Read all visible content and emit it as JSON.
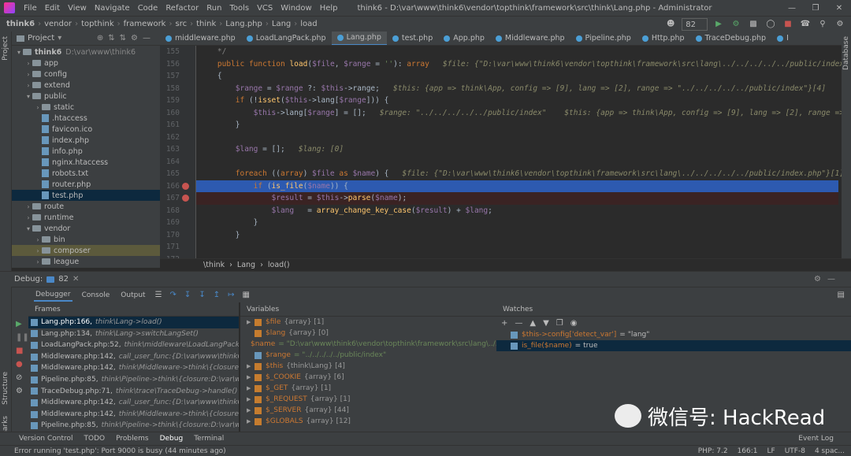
{
  "window": {
    "title": "think6 - D:\\var\\www\\think6\\vendor\\topthink\\framework\\src\\think\\Lang.php - Administrator"
  },
  "menu": [
    "File",
    "Edit",
    "View",
    "Navigate",
    "Code",
    "Refactor",
    "Run",
    "Tools",
    "VCS",
    "Window",
    "Help"
  ],
  "breadcrumb": [
    "think6",
    "vendor",
    "topthink",
    "framework",
    "src",
    "think",
    "Lang.php",
    "Lang",
    "load"
  ],
  "toolbar": {
    "run_config": "82"
  },
  "project": {
    "header": "Project",
    "tree": [
      {
        "label": "think6",
        "extra": "D:\\var\\www\\think6",
        "type": "folder",
        "indent": 0,
        "open": true
      },
      {
        "label": "app",
        "type": "folder",
        "indent": 1
      },
      {
        "label": "config",
        "type": "folder",
        "indent": 1
      },
      {
        "label": "extend",
        "type": "folder",
        "indent": 1
      },
      {
        "label": "public",
        "type": "folder",
        "indent": 1,
        "open": true
      },
      {
        "label": "static",
        "type": "folder",
        "indent": 2
      },
      {
        "label": ".htaccess",
        "type": "file",
        "indent": 2
      },
      {
        "label": "favicon.ico",
        "type": "file",
        "indent": 2
      },
      {
        "label": "index.php",
        "type": "file",
        "indent": 2
      },
      {
        "label": "info.php",
        "type": "file",
        "indent": 2
      },
      {
        "label": "nginx.htaccess",
        "type": "file",
        "indent": 2
      },
      {
        "label": "robots.txt",
        "type": "file",
        "indent": 2
      },
      {
        "label": "router.php",
        "type": "file",
        "indent": 2
      },
      {
        "label": "test.php",
        "type": "file",
        "indent": 2,
        "selected": true
      },
      {
        "label": "route",
        "type": "folder",
        "indent": 1
      },
      {
        "label": "runtime",
        "type": "folder",
        "indent": 1
      },
      {
        "label": "vendor",
        "type": "folder",
        "indent": 1,
        "open": true
      },
      {
        "label": "bin",
        "type": "folder",
        "indent": 2
      },
      {
        "label": "composer",
        "type": "folder",
        "indent": 2,
        "selected": true
      },
      {
        "label": "league",
        "type": "folder",
        "indent": 2
      }
    ]
  },
  "tabs": [
    "middleware.php",
    "LoadLangPack.php",
    "Lang.php",
    "test.php",
    "App.php",
    "Middleware.php",
    "Pipeline.php",
    "Http.php",
    "TraceDebug.php",
    "I"
  ],
  "active_tab": "Lang.php",
  "editor": {
    "line_numbers": [
      "155",
      "156",
      "157",
      "158",
      "159",
      "160",
      "161",
      "162",
      "163",
      "164",
      "165",
      "166",
      "167",
      "168",
      "169",
      "170",
      "171",
      "172"
    ],
    "lines": [
      {
        "code": "    */",
        "hint": ""
      },
      {
        "code": "    public function load($file, $range = ''): array",
        "hint": "   $file: {\"D:\\var\\www\\think6\\vendor\\topthink\\framework\\src\\lang\\../../../../../public/index.php\"}"
      },
      {
        "code": "    {",
        "hint": ""
      },
      {
        "code": "        $range = $range ?: $this->range;",
        "hint": "   $this: {app => think\\App, config => [9], lang => [2], range => \"../../../../../public/index\"}[4]"
      },
      {
        "code": "        if (!isset($this->lang[$range])) {",
        "hint": ""
      },
      {
        "code": "            $this->lang[$range] = [];",
        "hint": "   $range: \"../../../../../public/index\"    $this: {app => think\\App, config => [9], lang => [2], range => \""
      },
      {
        "code": "        }",
        "hint": ""
      },
      {
        "code": "",
        "hint": ""
      },
      {
        "code": "        $lang = [];",
        "hint": "   $lang: [0]"
      },
      {
        "code": "",
        "hint": ""
      },
      {
        "code": "        foreach ((array) $file as $name) {",
        "hint": "   $file: {\"D:\\var\\www\\think6\\vendor\\topthink\\framework\\src\\lang\\../../../../../public/index.php\"}[1]"
      },
      {
        "code": "            if (is_file($name)) {",
        "hint": ""
      },
      {
        "code": "                $result = $this->parse($name);",
        "hint": ""
      },
      {
        "code": "                $lang   = array_change_key_case($result) + $lang;",
        "hint": ""
      },
      {
        "code": "            }",
        "hint": ""
      },
      {
        "code": "        }",
        "hint": ""
      },
      {
        "code": "",
        "hint": ""
      },
      {
        "code": "",
        "hint": ""
      }
    ],
    "crumb": [
      "\\think",
      "Lang",
      "load()"
    ]
  },
  "debug": {
    "label": "Debug:",
    "session": "82",
    "tabs": [
      "Debugger",
      "Console",
      "Output"
    ],
    "frames_header": "Frames",
    "frames": [
      {
        "loc": "Lang.php:166,",
        "fn": "think\\Lang->load()",
        "selected": true
      },
      {
        "loc": "Lang.php:134,",
        "fn": "think\\Lang->switchLangSet()"
      },
      {
        "loc": "LoadLangPack.php:52,",
        "fn": "think\\middleware\\LoadLangPack->handle()"
      },
      {
        "loc": "Middleware.php:142,",
        "fn": "call_user_func:{D:\\var\\www\\think6\\vendor\\}"
      },
      {
        "loc": "Middleware.php:142,",
        "fn": "think\\Middleware->think\\{closure:D:\\var\\www}"
      },
      {
        "loc": "Pipeline.php:85,",
        "fn": "think\\Pipeline->think\\{closure:D:\\var\\www\\thin}"
      },
      {
        "loc": "TraceDebug.php:71,",
        "fn": "think\\trace\\TraceDebug->handle()"
      },
      {
        "loc": "Middleware.php:142,",
        "fn": "call_user_func:{D:\\var\\www\\think6\\vendor\\}"
      },
      {
        "loc": "Middleware.php:142,",
        "fn": "think\\Middleware->think\\{closure:D:\\var\\www}"
      },
      {
        "loc": "Pipeline.php:85,",
        "fn": "think\\Pipeline->think\\{closure:D:\\var\\www\\thin}"
      }
    ],
    "vars_header": "Variables",
    "variables": [
      {
        "name": "$file",
        "type": "{array} [1]",
        "expand": true
      },
      {
        "name": "$lang",
        "type": "{array} [0]",
        "expand": false
      },
      {
        "name": "$name",
        "type": "",
        "value": "= \"D:\\var\\www\\think6\\vendor\\topthink\\framework\\src\\lang\\../../..",
        "expand": false
      },
      {
        "name": "$range",
        "type": "",
        "value": "= \"../../../../../public/index\"",
        "expand": false
      },
      {
        "name": "$this",
        "type": "{think\\Lang} [4]",
        "expand": true
      },
      {
        "name": "$_COOKIE",
        "type": "{array} [6]",
        "expand": true
      },
      {
        "name": "$_GET",
        "type": "{array} [1]",
        "expand": true
      },
      {
        "name": "$_REQUEST",
        "type": "{array} [1]",
        "expand": true
      },
      {
        "name": "$_SERVER",
        "type": "{array} [44]",
        "expand": true
      },
      {
        "name": "$GLOBALS",
        "type": "{array} [12]",
        "expand": true
      }
    ],
    "watches_header": "Watches",
    "watches": [
      {
        "expr": "$this->config['detect_var']",
        "value": "= \"lang\""
      },
      {
        "expr": "is_file($name)",
        "value": "= true",
        "selected": true
      }
    ]
  },
  "bottom_tabs": [
    "Version Control",
    "TODO",
    "Problems",
    "Debug",
    "Terminal"
  ],
  "active_bottom_tab": "Debug",
  "event_log": "Event Log",
  "status": {
    "message": "Error running 'test.php': Port 9000 is busy (44 minutes ago)",
    "php": "PHP: 7.2",
    "pos": "166:1",
    "eol": "LF",
    "enc": "UTF-8",
    "indent": "4 spac..."
  },
  "watermark": "微信号: HackRead",
  "side_labels": {
    "project": "Project",
    "structure": "Structure",
    "bookmarks": "Bookmarks",
    "database": "Database"
  }
}
